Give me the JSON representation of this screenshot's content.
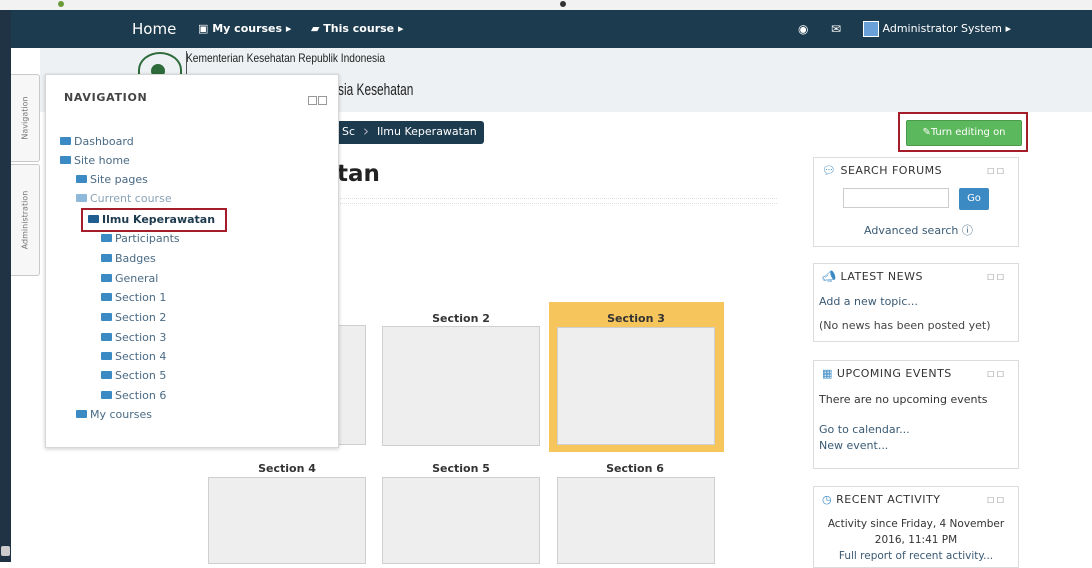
{
  "navbar": {
    "home": "Home",
    "my_courses": "My courses",
    "this_course": "This course",
    "user_name": "Administrator System"
  },
  "header": {
    "org_line1": "Kementerian Kesehatan Republik Indonesia",
    "org_line2_partial": "sia Kesehatan"
  },
  "side_tabs": {
    "navigation": "Navigation",
    "administration": "Administration"
  },
  "nav_block": {
    "title": "NAVIGATION",
    "items": [
      {
        "label": "Dashboard"
      },
      {
        "label": "Site home"
      },
      {
        "label": "Site pages"
      },
      {
        "label": "Current course"
      },
      {
        "label": "Ilmu Keperawatan"
      },
      {
        "label": "Participants"
      },
      {
        "label": "Badges"
      },
      {
        "label": "General"
      },
      {
        "label": "Section 1"
      },
      {
        "label": "Section 2"
      },
      {
        "label": "Section 3"
      },
      {
        "label": "Section 4"
      },
      {
        "label": "Section 5"
      },
      {
        "label": "Section 6"
      },
      {
        "label": "My courses"
      }
    ]
  },
  "breadcrumb": {
    "partial": "Sc",
    "current": "Ilmu Keperawatan"
  },
  "course": {
    "title_partial": "tan"
  },
  "edit_button": "Turn editing on",
  "sections": {
    "s2": "Section 2",
    "s3": "Section 3",
    "s4": "Section 4",
    "s5": "Section 5",
    "s6": "Section 6"
  },
  "search_forums": {
    "title": "SEARCH FORUMS",
    "go": "Go",
    "advanced": "Advanced search"
  },
  "latest_news": {
    "title": "LATEST NEWS",
    "add": "Add a new topic...",
    "none": "(No news has been posted yet)"
  },
  "upcoming_events": {
    "title": "UPCOMING EVENTS",
    "none": "There are no upcoming events",
    "calendar": "Go to calendar...",
    "new_event": "New event..."
  },
  "recent_activity": {
    "title": "RECENT ACTIVITY",
    "since_line1": "Activity since Friday, 4 November",
    "since_line2": "2016, 11:41 PM",
    "full_report": "Full report of recent activity..."
  },
  "colors": {
    "navbar": "#1d3b4f",
    "edit_button": "#5cb85c",
    "highlight_section": "#f6c55c",
    "annotation_red": "#b22222",
    "link": "#3a5a74",
    "go_button": "#3b8ac4"
  }
}
